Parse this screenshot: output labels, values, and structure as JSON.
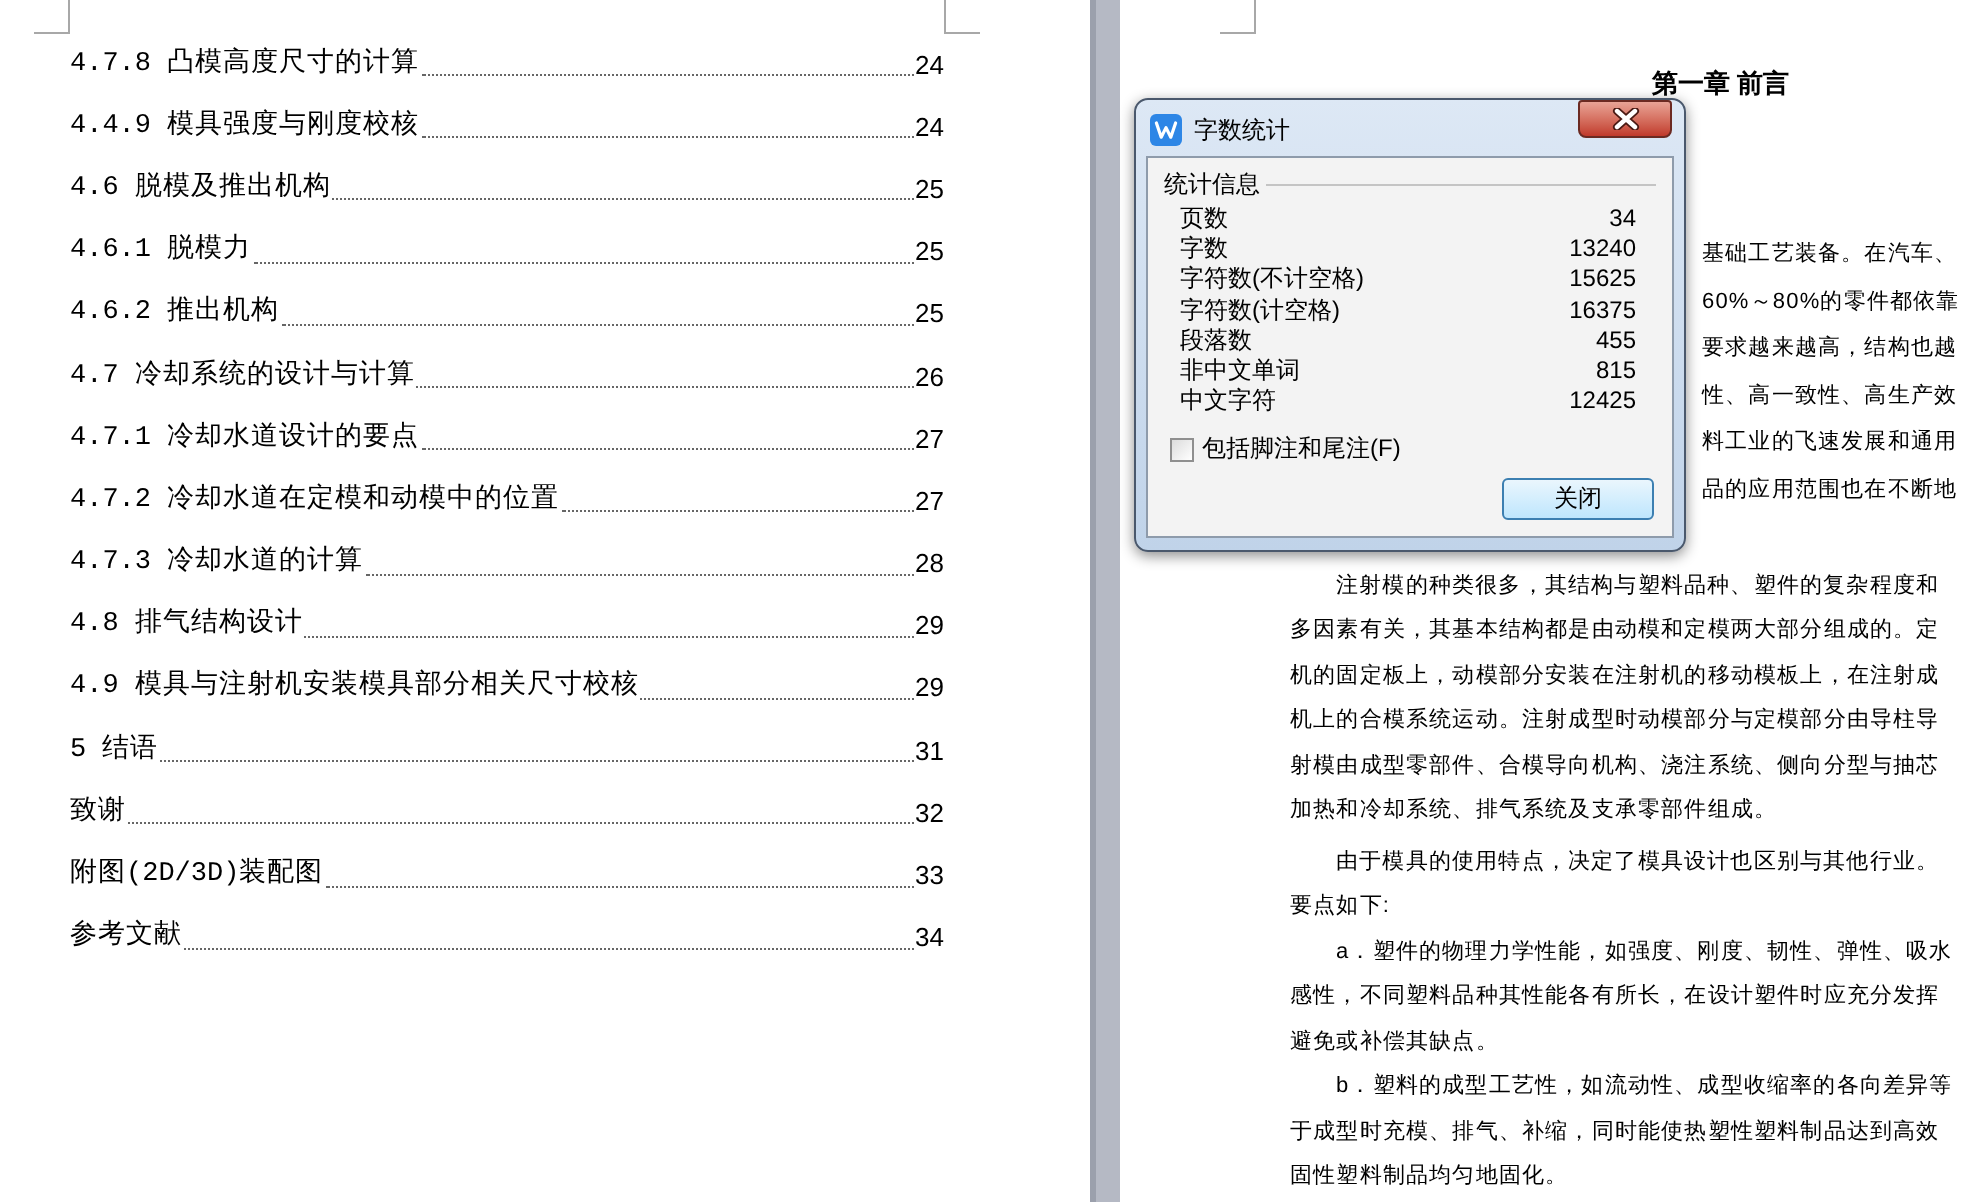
{
  "toc": {
    "entries": [
      {
        "title": "4.7.8 凸模高度尺寸的计算",
        "page": "24"
      },
      {
        "title": "4.4.9 模具强度与刚度校核",
        "page": "24"
      },
      {
        "title": "4.6 脱模及推出机构",
        "page": "25"
      },
      {
        "title": "4.6.1 脱模力",
        "page": "25"
      },
      {
        "title": "4.6.2 推出机构",
        "page": "25"
      },
      {
        "title": "4.7 冷却系统的设计与计算",
        "page": "26"
      },
      {
        "title": "4.7.1 冷却水道设计的要点",
        "page": "27"
      },
      {
        "title": "4.7.2 冷却水道在定模和动模中的位置",
        "page": "27"
      },
      {
        "title": "4.7.3 冷却水道的计算",
        "page": "28"
      },
      {
        "title": "4.8 排气结构设计",
        "page": "29"
      },
      {
        "title": "4.9 模具与注射机安装模具部分相关尺寸校核",
        "page": "29"
      },
      {
        "title": "5 结语",
        "page": "31"
      },
      {
        "title": "致谢",
        "page": "32"
      },
      {
        "title": "附图(2D/3D)装配图",
        "page": "33"
      },
      {
        "title": "参考文献",
        "page": "34"
      }
    ]
  },
  "document_page": {
    "heading": "第一章 前言",
    "partial_lines": [
      "基础工艺装备。在汽车、",
      "60%～80%的零件都依靠",
      "要求越来越高，结构也越",
      "性、高一致性、高生产效",
      "料工业的飞速发展和通用",
      "品的应用范围也在不断地"
    ],
    "paragraphs": [
      {
        "lines": [
          "注射模的种类很多，其结构与塑料品种、塑件的复杂程度和",
          "多因素有关，其基本结构都是由动模和定模两大部分组成的。定",
          "机的固定板上，动模部分安装在注射机的移动模板上，在注射成",
          "机上的合模系统运动。注射成型时动模部分与定模部分由导柱导",
          "射模由成型零部件、合模导向机构、浇注系统、侧向分型与抽芯",
          "加热和冷却系统、排气系统及支承零部件组成。"
        ]
      },
      {
        "lines": [
          "由于模具的使用特点，决定了模具设计也区别与其他行业。",
          "要点如下:"
        ]
      },
      {
        "lines": [
          "a．塑件的物理力学性能，如强度、刚度、韧性、弹性、吸水",
          "感性，不同塑料品种其性能各有所长，在设计塑件时应充分发挥",
          "避免或补偿其缺点。"
        ]
      },
      {
        "lines": [
          "b．塑料的成型工艺性，如流动性、成型收缩率的各向差异等",
          "于成型时充模、排气、补缩，同时能使热塑性塑料制品达到高效",
          "固性塑料制品均匀地固化。"
        ]
      }
    ]
  },
  "dialog": {
    "title": "字数统计",
    "section": "统计信息",
    "stats": [
      {
        "label": "页数",
        "value": "34"
      },
      {
        "label": "字数",
        "value": "13240"
      },
      {
        "label": "字符数(不计空格)",
        "value": "15625"
      },
      {
        "label": "字符数(计空格)",
        "value": "16375"
      },
      {
        "label": "段落数",
        "value": "455"
      },
      {
        "label": "非中文单词",
        "value": "815"
      },
      {
        "label": "中文字符",
        "value": "12425"
      }
    ],
    "checkbox": {
      "label": "包括脚注和尾注(F)",
      "checked": false
    },
    "buttons": [
      {
        "label": "关闭",
        "default": true
      }
    ]
  }
}
